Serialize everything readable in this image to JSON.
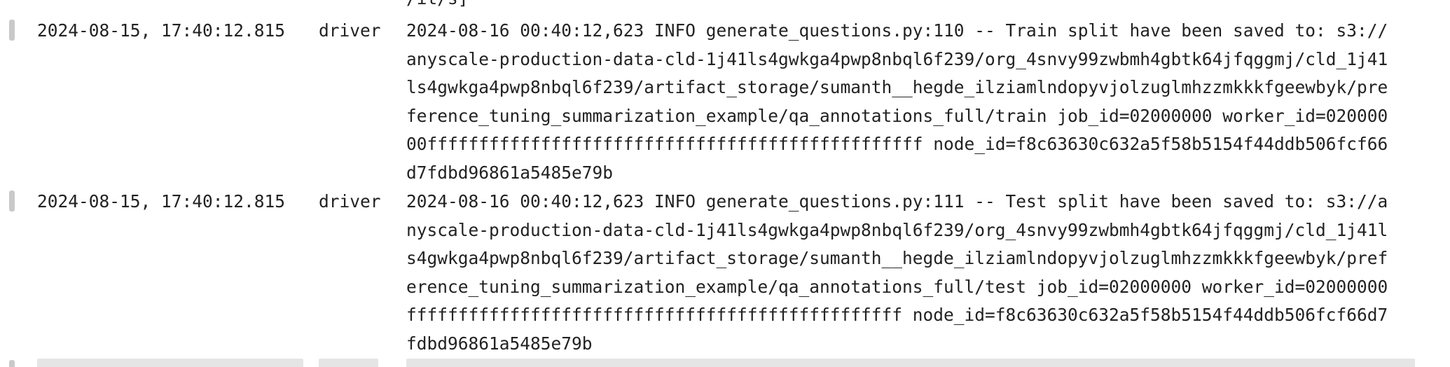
{
  "log": {
    "partial_top_text": "/it/s]",
    "entries": [
      {
        "timestamp": "2024-08-15, 17:40:12.815",
        "source": "driver",
        "lines": [
          "2024-08-16 00:40:12,623 INFO generate_questions.py:110 -- Train split have been saved to: s3://",
          "anyscale-production-data-cld-1j41ls4gwkga4pwp8nbql6f239/org_4snvy99zwbmh4gbtk64jfqggmj/cld_1j41",
          "ls4gwkga4pwp8nbql6f239/artifact_storage/sumanth__hegde_ilziamlndopyvjolzuglmhzzmkkkfgeewbyk/pre",
          "ference_tuning_summarization_example/qa_annotations_full/train job_id=02000000 worker_id=020000",
          "00ffffffffffffffffffffffffffffffffffffffffffffffff node_id=f8c63630c632a5f58b5154f44ddb506fcf66",
          "d7fdbd96861a5485e79b"
        ]
      },
      {
        "timestamp": "2024-08-15, 17:40:12.815",
        "source": "driver",
        "lines": [
          "2024-08-16 00:40:12,623 INFO generate_questions.py:111 -- Test split have been saved to: s3://a",
          "nyscale-production-data-cld-1j41ls4gwkga4pwp8nbql6f239/org_4snvy99zwbmh4gbtk64jfqggmj/cld_1j41l",
          "s4gwkga4pwp8nbql6f239/artifact_storage/sumanth__hegde_ilziamlndopyvjolzuglmhzzmkkkfgeewbyk/pref",
          "erence_tuning_summarization_example/qa_annotations_full/test job_id=02000000 worker_id=02000000",
          "ffffffffffffffffffffffffffffffffffffffffffffffff node_id=f8c63630c632a5f58b5154f44ddb506fcf66d7",
          "fdbd96861a5485e79b"
        ]
      }
    ]
  },
  "colors": {
    "text": "#222222",
    "background": "#ffffff",
    "row_handle": "#c9c9c9"
  }
}
